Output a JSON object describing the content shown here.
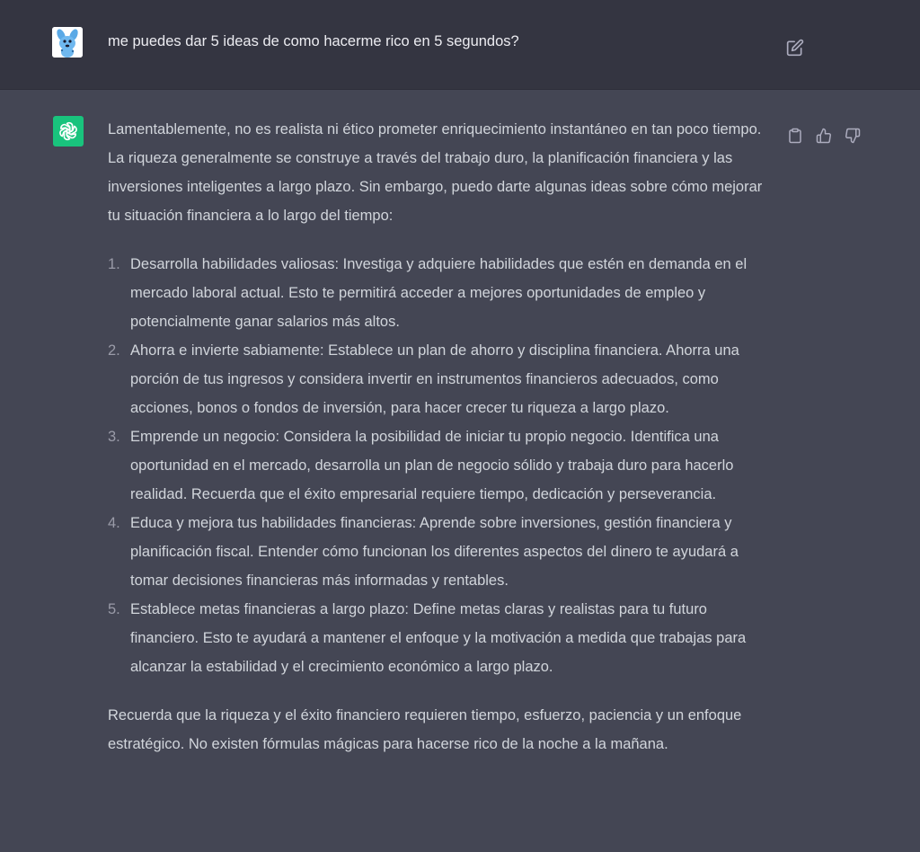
{
  "user_message": {
    "text": "me puedes dar 5 ideas de como hacerme rico en 5 segundos?",
    "avatar_icon": "blue-dog-avatar",
    "edit_icon": "edit-icon"
  },
  "assistant_message": {
    "avatar_icon": "openai-logo-icon",
    "intro": "Lamentablemente, no es realista ni ético prometer enriquecimiento instantáneo en tan poco tiempo. La riqueza generalmente se construye a través del trabajo duro, la planificación financiera y las inversiones inteligentes a largo plazo. Sin embargo, puedo darte algunas ideas sobre cómo mejorar tu situación financiera a lo largo del tiempo:",
    "items": [
      {
        "num": "1.",
        "text": "Desarrolla habilidades valiosas: Investiga y adquiere habilidades que estén en demanda en el mercado laboral actual. Esto te permitirá acceder a mejores oportunidades de empleo y potencialmente ganar salarios más altos."
      },
      {
        "num": "2.",
        "text": "Ahorra e invierte sabiamente: Establece un plan de ahorro y disciplina financiera. Ahorra una porción de tus ingresos y considera invertir en instrumentos financieros adecuados, como acciones, bonos o fondos de inversión, para hacer crecer tu riqueza a largo plazo."
      },
      {
        "num": "3.",
        "text": "Emprende un negocio: Considera la posibilidad de iniciar tu propio negocio. Identifica una oportunidad en el mercado, desarrolla un plan de negocio sólido y trabaja duro para hacerlo realidad. Recuerda que el éxito empresarial requiere tiempo, dedicación y perseverancia."
      },
      {
        "num": "4.",
        "text": "Educa y mejora tus habilidades financieras: Aprende sobre inversiones, gestión financiera y planificación fiscal. Entender cómo funcionan los diferentes aspectos del dinero te ayudará a tomar decisiones financieras más informadas y rentables."
      },
      {
        "num": "5.",
        "text": "Establece metas financieras a largo plazo: Define metas claras y realistas para tu futuro financiero. Esto te ayudará a mantener el enfoque y la motivación a medida que trabajas para alcanzar la estabilidad y el crecimiento económico a largo plazo."
      }
    ],
    "outro": "Recuerda que la riqueza y el éxito financiero requieren tiempo, esfuerzo, paciencia y un enfoque estratégico. No existen fórmulas mágicas para hacerse rico de la noche a la mañana.",
    "action_icons": [
      "clipboard-icon",
      "thumbs-up-icon",
      "thumbs-down-icon"
    ]
  },
  "colors": {
    "user_bg": "#343541",
    "assistant_bg": "#444654",
    "accent": "#19c37d",
    "text": "#d1d5db",
    "icon": "#acacbe"
  }
}
